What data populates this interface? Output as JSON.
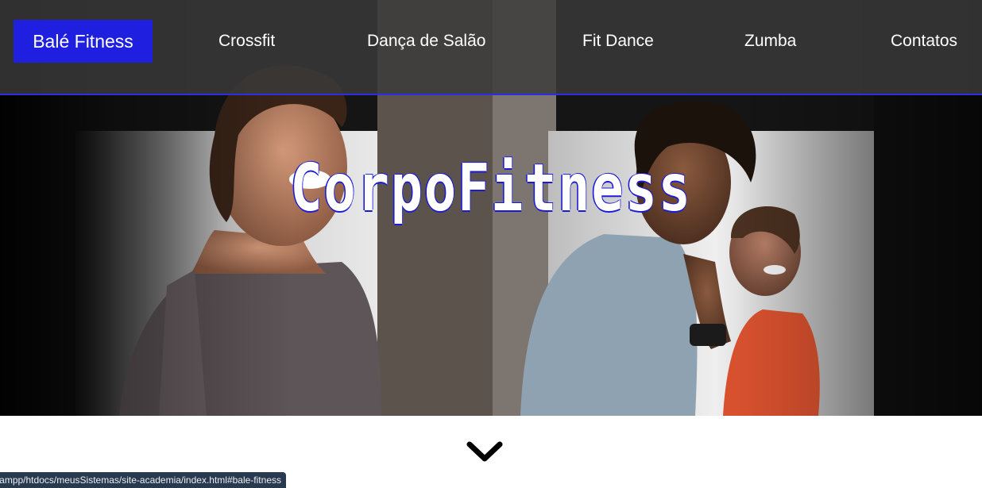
{
  "navbar": {
    "items": [
      {
        "label": "Balé Fitness",
        "active": true
      },
      {
        "label": "Crossfit",
        "active": false
      },
      {
        "label": "Dança de Salão",
        "active": false
      },
      {
        "label": "Fit Dance",
        "active": false
      },
      {
        "label": "Zumba",
        "active": false
      },
      {
        "label": "Contatos",
        "active": false
      }
    ]
  },
  "hero": {
    "title": "CorpoFitness",
    "image_description_icon": "people-exercising-photo"
  },
  "scroll_icon": "chevron-down-icon",
  "status_bar": {
    "url": "ampp/htdocs/meusSistemas/site-academia/index.html#bale-fitness"
  },
  "colors": {
    "accent": "#1f1fe0",
    "navbar_bg": "#3a3a3a",
    "text": "#ffffff"
  }
}
